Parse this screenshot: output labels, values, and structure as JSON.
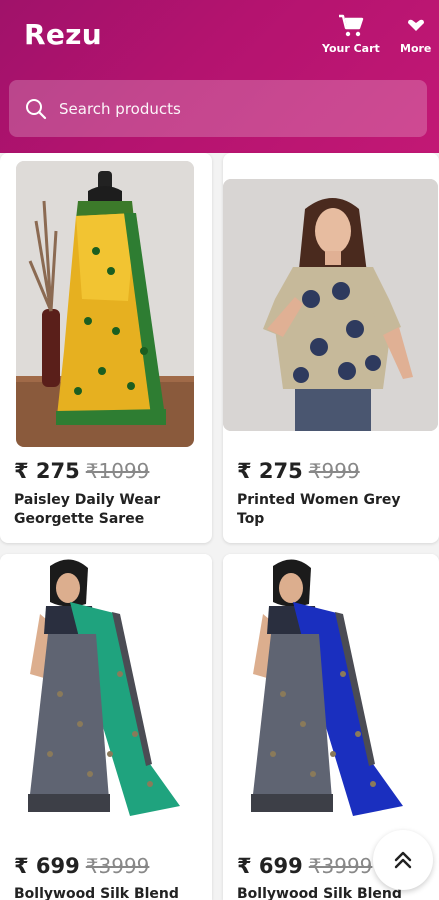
{
  "header": {
    "brand": "Rezu",
    "cart_label": "Your Cart",
    "more_label": "More",
    "colors": {
      "gradient_start": "#a0126a",
      "gradient_end": "#c21875"
    }
  },
  "search": {
    "placeholder": "Search products"
  },
  "products": [
    {
      "price": "₹ 275",
      "mrp": "₹1099",
      "title": "Paisley Daily Wear Georgette Saree"
    },
    {
      "price": "₹ 275",
      "mrp": "₹999",
      "title": "Printed Women Grey Top"
    },
    {
      "price": "₹ 699",
      "mrp": "₹3999",
      "title": "Bollywood Silk Blend"
    },
    {
      "price": "₹ 699",
      "mrp": "₹3999",
      "title": "Bollywood Silk Blend"
    }
  ],
  "icons": {
    "cart": "cart-icon",
    "more": "chevron-down-icon",
    "search": "search-icon",
    "scroll_top": "double-chevron-up-icon"
  }
}
